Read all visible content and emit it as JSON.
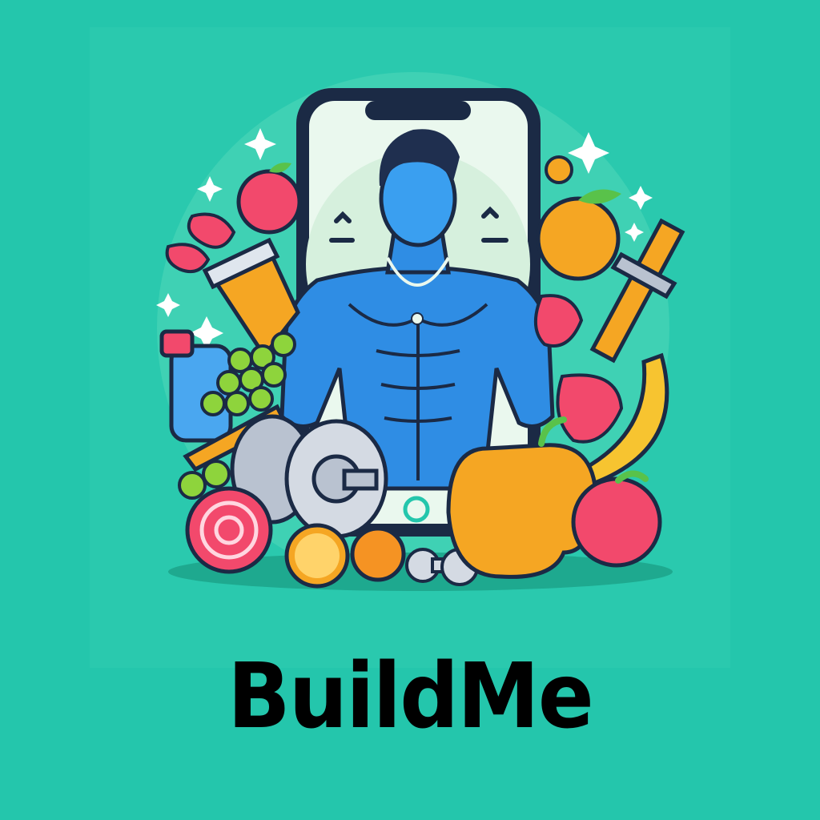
{
  "brand": {
    "name": "BuildMe"
  },
  "colors": {
    "background": "#24c6ac",
    "panel": "#2ac9ae",
    "skin": "#2f8de4",
    "hair": "#1f2f4f",
    "screen": "#eaf8ee",
    "apple": "#f2496c",
    "mango": "#f5a623",
    "banana": "#f7c430",
    "grape": "#8ed43c",
    "metal": "#b9c2d0",
    "text": "#000000"
  },
  "icons": [
    "smartphone-icon",
    "athlete-figure",
    "dumbbell-icon",
    "fruit-cluster",
    "protein-shaker-icon",
    "syringe-icon",
    "sparkle-icon"
  ]
}
